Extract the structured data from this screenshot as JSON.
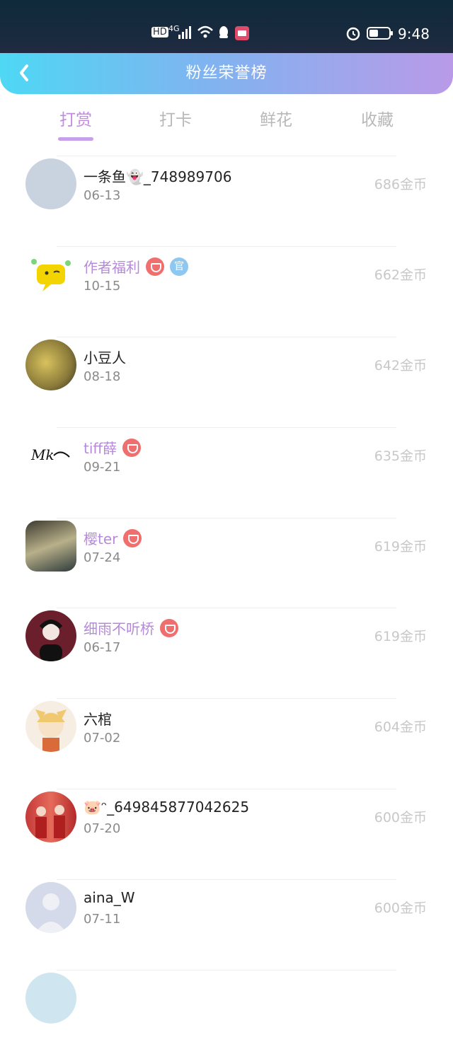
{
  "status_bar": {
    "hd": "HD",
    "network": "4G",
    "battery_icon": "battery-icon",
    "time": "9:48"
  },
  "header": {
    "title": "粉丝荣誉榜",
    "back_icon": "chevron-left-icon"
  },
  "tabs": [
    {
      "label": "打赏",
      "active": true
    },
    {
      "label": "打卡",
      "active": false
    },
    {
      "label": "鲜花",
      "active": false
    },
    {
      "label": "收藏",
      "active": false
    }
  ],
  "fans": [
    {
      "name": "一条鱼👻_748989706",
      "date": "06-13",
      "coins": "686金币",
      "vip": false,
      "official": false,
      "avatar_color": "#c9d3e0"
    },
    {
      "name": "作者福利",
      "date": "10-15",
      "coins": "662金币",
      "vip": true,
      "official": true,
      "avatar_color": "#f4d400"
    },
    {
      "name": "小豆人",
      "date": "08-18",
      "coins": "642金币",
      "vip": false,
      "official": false,
      "avatar_color": "#b9a552"
    },
    {
      "name": "tiff薛",
      "date": "09-21",
      "coins": "635金币",
      "vip": true,
      "official": false,
      "avatar_color": "#f2f2f2"
    },
    {
      "name": "樱ter",
      "date": "07-24",
      "coins": "619金币",
      "vip": true,
      "official": false,
      "avatar_color": "#8c8a72"
    },
    {
      "name": "细雨不听桥",
      "date": "06-17",
      "coins": "619金币",
      "vip": true,
      "official": false,
      "avatar_color": "#6b1f2c"
    },
    {
      "name": "六棺",
      "date": "07-02",
      "coins": "604金币",
      "vip": false,
      "official": false,
      "avatar_color": "#f1d7b3"
    },
    {
      "name": "🐷ᵔ_649845877042625",
      "date": "07-20",
      "coins": "600金币",
      "vip": false,
      "official": false,
      "avatar_color": "#c43a3a"
    },
    {
      "name": "aina_W",
      "date": "07-11",
      "coins": "600金币",
      "vip": false,
      "official": false,
      "avatar_color": "#d5daea"
    }
  ]
}
